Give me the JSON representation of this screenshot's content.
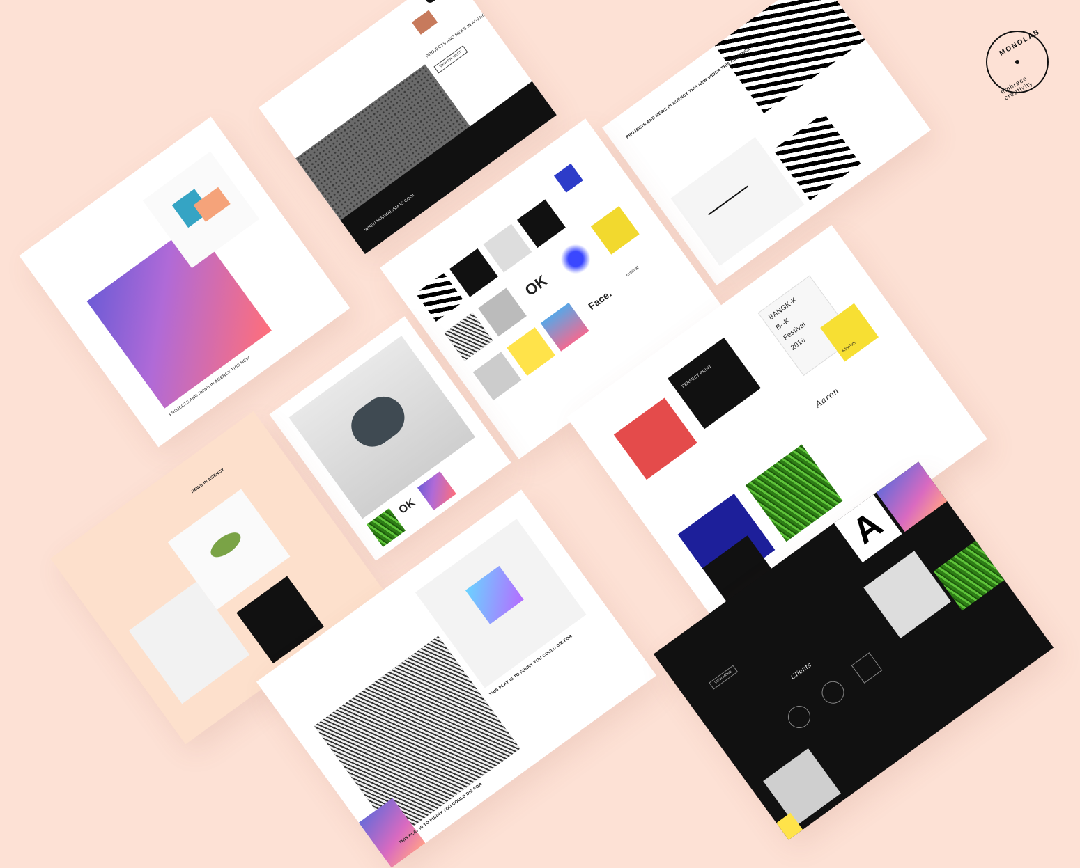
{
  "brand": {
    "name": "MONOLAB",
    "tagline": "embrace creativity"
  },
  "cards": {
    "c1": {
      "headline": "PROJECTS AND NEWS IN AGENCY THIS NEW"
    },
    "c2": {
      "headline": "PROJECTS AND NEWS IN AGENCY THIS NEW WIDER THIS AUDIENCE",
      "button": "VIEW PROJECT",
      "caption": "WHEN MINIMALISM IS COOL"
    },
    "c3": {
      "headline": "PROJECTS AND NEWS IN AGENCY THIS NEW WIDER THIS AUDIENCE"
    },
    "c4": {
      "word_ok": "OK",
      "word_face": "Face.",
      "word_fest": "festival"
    },
    "c5": {
      "word_ok": "OK"
    },
    "c6": {
      "headline": "NEWS IN AGENCY"
    },
    "c7": {
      "poster_lines": [
        "BANGK-K",
        "B--K",
        "Festival",
        "2018"
      ],
      "tag_rhythm": "Rhythm",
      "item_perfect": "PERFECT PRINT",
      "signature": "Aaron"
    },
    "c8": {
      "headline_a": "THIS PLAY IS TO FUNNY YOU COULD DIE FOR",
      "headline_b": "THIS PLAY IS TO FUNNY YOU COULD DIE FOR"
    },
    "c9": {
      "letter": "A",
      "clients_title": "Clients",
      "button": "VIEW MORE"
    }
  }
}
